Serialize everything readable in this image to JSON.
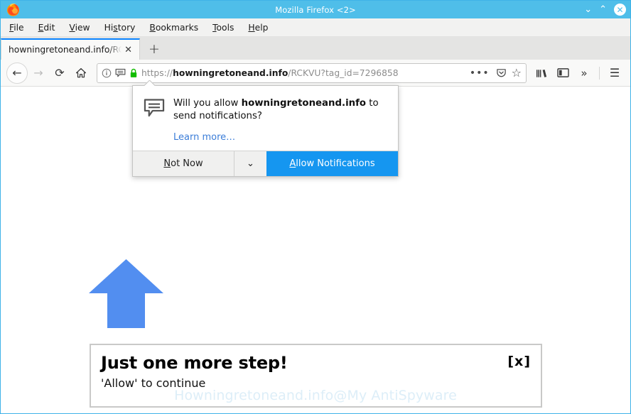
{
  "window": {
    "title": "Mozilla Firefox <2>",
    "logo_icon": "firefox-logo",
    "controls": {
      "minimize_glyph": "⌄",
      "maximize_glyph": "⌃",
      "close_glyph": "✕"
    },
    "accent_titlebar_color": "#4fbee9"
  },
  "menubar": {
    "items": [
      {
        "label": "File",
        "accesskey": "F"
      },
      {
        "label": "Edit",
        "accesskey": "E"
      },
      {
        "label": "View",
        "accesskey": "V"
      },
      {
        "label": "History",
        "accesskey": "s"
      },
      {
        "label": "Bookmarks",
        "accesskey": "B"
      },
      {
        "label": "Tools",
        "accesskey": "T"
      },
      {
        "label": "Help",
        "accesskey": "H"
      }
    ]
  },
  "tabbar": {
    "tabs": [
      {
        "label": "howningretoneand.info/RCKV",
        "close_glyph": "✕",
        "active": true
      }
    ],
    "new_tab_glyph": "+"
  },
  "navbar": {
    "back_glyph": "←",
    "forward_glyph": "→",
    "reload_glyph": "⟳",
    "home_icon": "home-icon",
    "url": {
      "scheme": "https://",
      "host": "howningretoneand.info",
      "path": "/RCKVU?tag_id=7296858",
      "identity_icon": "info-circle-icon",
      "permission_icon": "notification-bubble-icon",
      "lock_icon": "padlock-icon",
      "page_actions_glyph": "•••",
      "pocket_icon": "pocket-icon",
      "bookmark_star_glyph": "☆"
    },
    "right_tools": [
      {
        "name": "library-icon"
      },
      {
        "name": "sidebar-icon"
      },
      {
        "name": "overflow-chevron-icon",
        "glyph": "»"
      },
      {
        "name": "hamburger-menu-icon",
        "glyph": "☰"
      }
    ]
  },
  "permission_popup": {
    "icon": "notification-bubble-icon",
    "question_prefix": "Will you allow ",
    "question_domain": "howningretoneand.info",
    "question_suffix": " to send notifications?",
    "learn_more": "Learn more…",
    "not_now_label": "Not Now",
    "not_now_accesskey": "N",
    "dropdown_glyph": "⌄",
    "allow_label": "Allow Notifications",
    "allow_accesskey": "A",
    "allow_button_color": "#1596f0"
  },
  "page": {
    "arrow_icon": "blue-up-arrow",
    "arrow_color": "#528ef0",
    "box": {
      "title": "Just one more step!",
      "subtitle": "'Allow' to continue",
      "close_label": "[x]"
    },
    "watermark": "Howningretoneand.info@My AntiSpyware"
  }
}
